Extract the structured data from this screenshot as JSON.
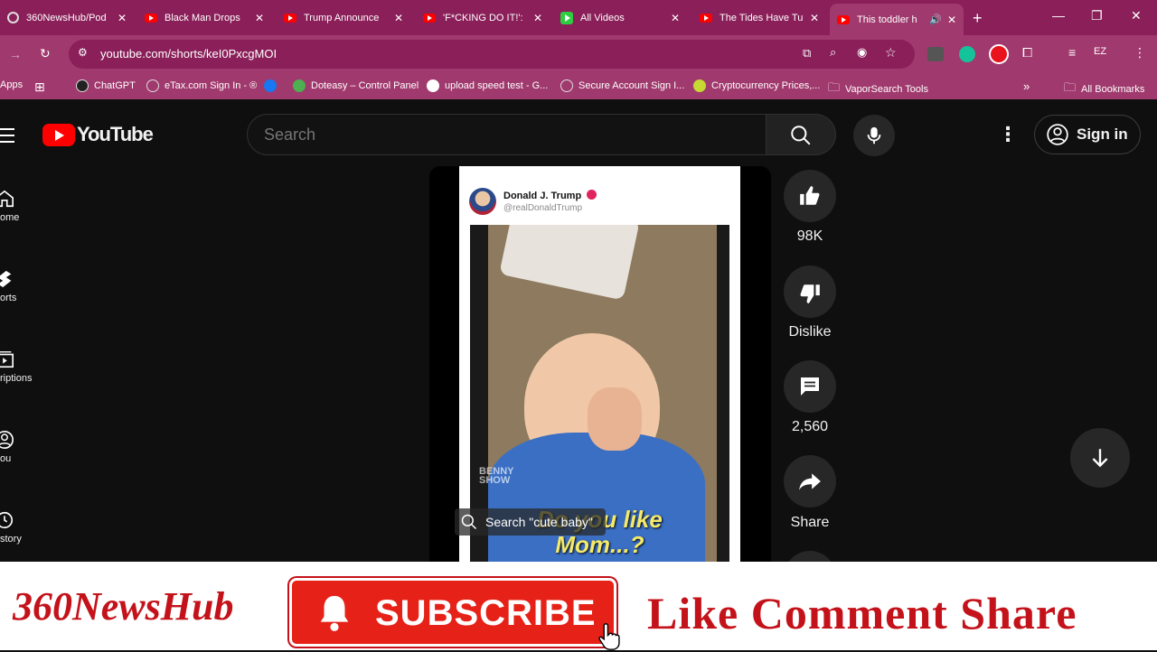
{
  "browser": {
    "tabs": [
      {
        "title": "360NewsHub/Pod",
        "favicon": "globe-icon"
      },
      {
        "title": "Black Man Drops",
        "favicon": "youtube-icon"
      },
      {
        "title": "Trump Announce",
        "favicon": "youtube-icon"
      },
      {
        "title": "'F*CKING DO IT!':",
        "favicon": "youtube-icon"
      },
      {
        "title": "All Videos",
        "favicon": "play-green-icon"
      },
      {
        "title": "The Tides Have Tu",
        "favicon": "youtube-icon"
      },
      {
        "title": "This toddler h",
        "favicon": "youtube-icon",
        "active": true,
        "audio": true
      }
    ],
    "url": "youtube.com/shorts/keI0PxcgMOI",
    "profile_initials": "EZ",
    "bookmarks": [
      {
        "label": "Apps"
      },
      {
        "label": "ChatGPT"
      },
      {
        "label": "eTax.com Sign In - ®"
      },
      {
        "label": ""
      },
      {
        "label": "Doteasy – Control Panel"
      },
      {
        "label": "upload speed test - G..."
      },
      {
        "label": "Secure Account Sign I..."
      },
      {
        "label": "Cryptocurrency Prices,..."
      },
      {
        "label": "VaporSearch Tools"
      }
    ],
    "all_bookmarks": "All Bookmarks",
    "colors": {
      "frame": "#8a1f59",
      "toolbar": "#a0396d"
    }
  },
  "youtube": {
    "logo_text": "YouTube",
    "search_placeholder": "Search",
    "sign_in": "Sign in",
    "nav": [
      {
        "label": "ome",
        "icon": "home-icon"
      },
      {
        "label": "orts",
        "icon": "shorts-icon"
      },
      {
        "label": "riptions",
        "icon": "subscriptions-icon"
      },
      {
        "label": "ou",
        "icon": "you-icon"
      },
      {
        "label": "story",
        "icon": "history-icon"
      }
    ],
    "actions": {
      "like_count": "98K",
      "dislike_label": "Dislike",
      "comment_count": "2,560",
      "share_label": "Share"
    },
    "video": {
      "author_name": "Donald J. Trump",
      "author_handle": "@realDonaldTrump",
      "watermark": "BENNY SHOW",
      "caption_line1": "Do you like",
      "caption_line2": "Mom...?",
      "search_suggestion": "Search \"cute baby\""
    }
  },
  "banner": {
    "channel": "360NewsHub",
    "subscribe": "SUBSCRIBE",
    "cta": "Like Comment Share",
    "colors": {
      "red": "#c4121a",
      "button": "#e62117"
    }
  }
}
